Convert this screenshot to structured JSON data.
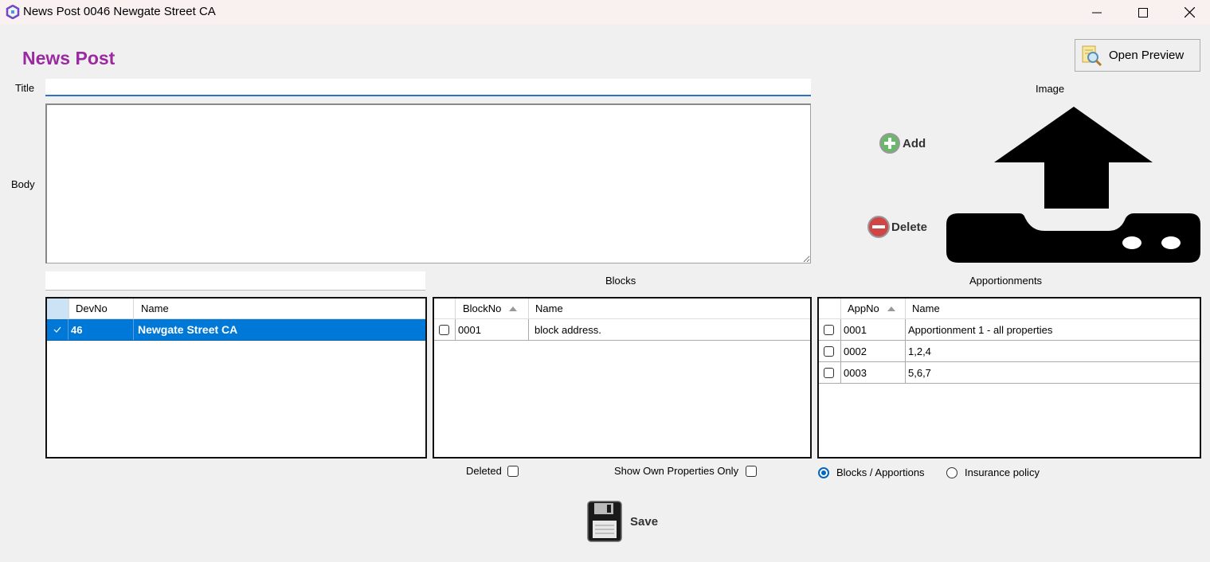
{
  "window": {
    "title": "News Post 0046 Newgate Street CA"
  },
  "page": {
    "heading": "News Post"
  },
  "labels": {
    "title": "Title",
    "body": "Body",
    "image": "Image",
    "blocks": "Blocks",
    "apportionments": "Apportionments"
  },
  "buttons": {
    "open_preview": "Open Preview",
    "add": "Add",
    "delete": "Delete",
    "save": "Save"
  },
  "form": {
    "title_value": "",
    "body_value": "",
    "dev_search_value": ""
  },
  "dev_grid": {
    "columns": [
      "DevNo",
      "Name"
    ],
    "rows": [
      {
        "devno": "46",
        "name": "Newgate Street CA",
        "selected": true
      }
    ]
  },
  "blocks_grid": {
    "columns": [
      "BlockNo",
      "Name"
    ],
    "rows": [
      {
        "blockno": "0001",
        "name": "block address."
      }
    ]
  },
  "app_grid": {
    "columns": [
      "AppNo",
      "Name"
    ],
    "rows": [
      {
        "appno": "0001",
        "name": "Apportionment 1 - all properties"
      },
      {
        "appno": "0002",
        "name": "1,2,4"
      },
      {
        "appno": "0003",
        "name": "5,6,7"
      }
    ]
  },
  "options": {
    "deleted": "Deleted",
    "show_own": "Show Own Properties Only",
    "radio_blocks": "Blocks / Apportions",
    "radio_insurance": "Insurance policy",
    "selected_radio": "Blocks / Apportions"
  },
  "colors": {
    "heading": "#9b2aa2",
    "selection": "#0078d7",
    "accent": "#0067c0"
  }
}
